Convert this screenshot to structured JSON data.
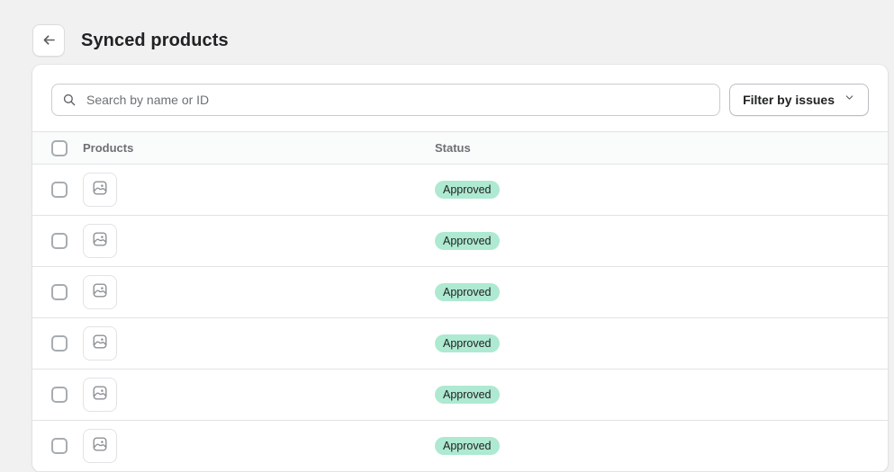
{
  "header": {
    "back_icon": "arrow-left-icon",
    "title": "Synced products"
  },
  "toolbar": {
    "search": {
      "icon": "search-icon",
      "placeholder": "Search by name or ID",
      "value": ""
    },
    "filter": {
      "label": "Filter by issues",
      "icon": "chevron-down-icon"
    }
  },
  "table": {
    "columns": {
      "products": "Products",
      "status": "Status"
    },
    "select_all_checked": false,
    "rows": [
      {
        "selected": false,
        "thumbnail_icon": "image-placeholder-icon",
        "name": "",
        "status": "Approved"
      },
      {
        "selected": false,
        "thumbnail_icon": "image-placeholder-icon",
        "name": "",
        "status": "Approved"
      },
      {
        "selected": false,
        "thumbnail_icon": "image-placeholder-icon",
        "name": "",
        "status": "Approved"
      },
      {
        "selected": false,
        "thumbnail_icon": "image-placeholder-icon",
        "name": "",
        "status": "Approved"
      },
      {
        "selected": false,
        "thumbnail_icon": "image-placeholder-icon",
        "name": "",
        "status": "Approved"
      },
      {
        "selected": false,
        "thumbnail_icon": "image-placeholder-icon",
        "name": "",
        "status": "Approved"
      }
    ]
  },
  "colors": {
    "page_background": "#f1f1f1",
    "card_background": "#ffffff",
    "badge_approved_bg": "#aee9d1",
    "text_primary": "#202223",
    "text_subdued": "#6d7175",
    "border": "#e1e3e5"
  }
}
